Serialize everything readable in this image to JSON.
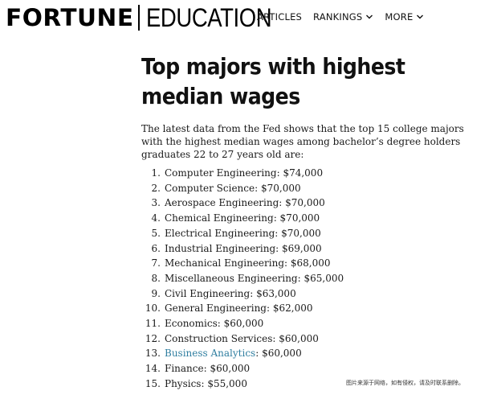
{
  "header": {
    "brand_primary": "FORTUNE",
    "brand_secondary": "EDUCATION",
    "nav": [
      {
        "label": "ARTICLES",
        "has_dropdown": false
      },
      {
        "label": "RANKINGS",
        "has_dropdown": true
      },
      {
        "label": "MORE",
        "has_dropdown": true
      }
    ]
  },
  "article": {
    "title": "Top majors with highest median wages",
    "intro": "The latest data from the Fed shows that the top 15 college majors with the highest median wages among bachelor’s degree holders graduates 22 to 27 years old are:",
    "majors": [
      {
        "num": "1.",
        "name": "Computer Engineering",
        "wage": "$74,000"
      },
      {
        "num": "2.",
        "name": "Computer Science",
        "wage": "$70,000"
      },
      {
        "num": "3.",
        "name": "Aerospace Engineering",
        "wage": "$70,000"
      },
      {
        "num": "4.",
        "name": "Chemical Engineering",
        "wage": "$70,000"
      },
      {
        "num": "5.",
        "name": "Electrical Engineering",
        "wage": "$70,000"
      },
      {
        "num": "6.",
        "name": "Industrial Engineering",
        "wage": "$69,000"
      },
      {
        "num": "7.",
        "name": "Mechanical Engineering",
        "wage": "$68,000"
      },
      {
        "num": "8.",
        "name": "Miscellaneous Engineering",
        "wage": "$65,000"
      },
      {
        "num": "9.",
        "name": "Civil Engineering",
        "wage": "$63,000"
      },
      {
        "num": "10.",
        "name": "General Engineering",
        "wage": "$62,000"
      },
      {
        "num": "11.",
        "name": "Economics",
        "wage": "$60,000"
      },
      {
        "num": "12.",
        "name": "Construction Services",
        "wage": "$60,000"
      },
      {
        "num": "13.",
        "name": "Business Analytics",
        "wage": "$60,000",
        "is_link": true
      },
      {
        "num": "14.",
        "name": "Finance",
        "wage": "$60,000"
      },
      {
        "num": "15.",
        "name": "Physics",
        "wage": "$55,000"
      }
    ]
  },
  "watermark": "图片来源于网络，如有侵权，请及时联系删除。",
  "colors": {
    "link": "#2f7ea0",
    "text": "#1a1a1a",
    "heading": "#111111"
  }
}
